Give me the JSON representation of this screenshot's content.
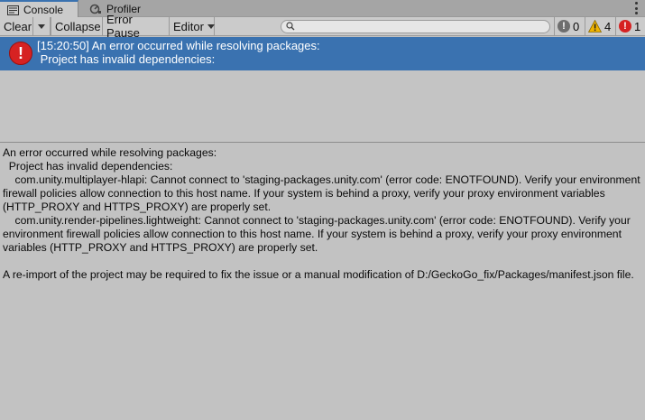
{
  "tabs": [
    {
      "label": "Console",
      "icon": "console-icon",
      "active": true
    },
    {
      "label": "Profiler",
      "icon": "profiler-icon",
      "active": false
    }
  ],
  "toolbar": {
    "clear_label": "Clear",
    "collapse_label": "Collapse",
    "error_pause_label": "Error Pause",
    "editor_label": "Editor",
    "search_placeholder": "",
    "info_count": "0",
    "warning_count": "4",
    "error_count": "1"
  },
  "log": {
    "selected_entry": {
      "line1": "[15:20:50] An error occurred while resolving packages:",
      "line2": " Project has invalid dependencies:"
    }
  },
  "detail": {
    "text": "An error occurred while resolving packages:\n  Project has invalid dependencies:\n    com.unity.multiplayer-hlapi: Cannot connect to 'staging-packages.unity.com' (error code: ENOTFOUND). Verify your environment firewall policies allow connection to this host name. If your system is behind a proxy, verify your proxy environment variables (HTTP_PROXY and HTTPS_PROXY) are properly set.\n    com.unity.render-pipelines.lightweight: Cannot connect to 'staging-packages.unity.com' (error code: ENOTFOUND). Verify your environment firewall policies allow connection to this host name. If your system is behind a proxy, verify your proxy environment variables (HTTP_PROXY and HTTPS_PROXY) are properly set.\n\nA re-import of the project may be required to fix the issue or a manual modification of D:/GeckoGo_fix/Packages/manifest.json file."
  },
  "colors": {
    "selection": "#3a72b0",
    "error": "#d62222",
    "warning": "#f0b400",
    "panel": "#c2c2c2"
  }
}
